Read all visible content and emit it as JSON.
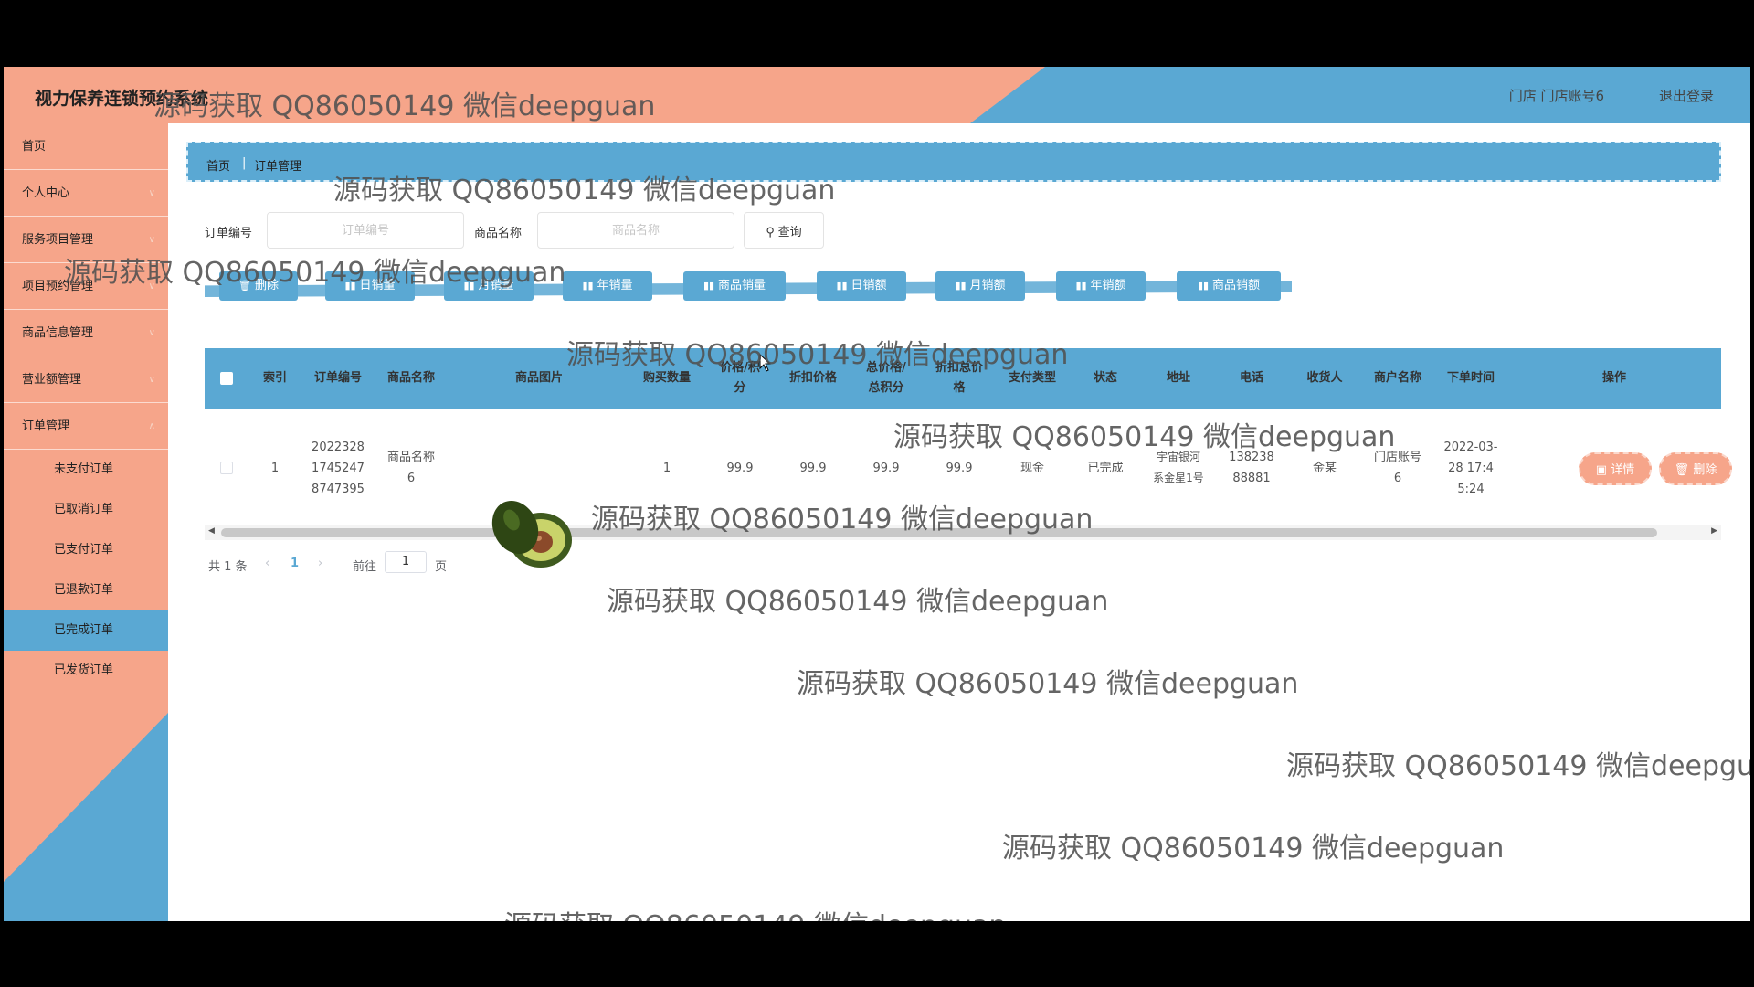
{
  "header": {
    "title": "视力保养连锁预约系统",
    "user": "门店 门店账号6",
    "logout": "退出登录"
  },
  "sidebar": {
    "items": [
      {
        "label": "首页"
      },
      {
        "label": "个人中心"
      },
      {
        "label": "服务项目管理"
      },
      {
        "label": "项目预约管理"
      },
      {
        "label": "商品信息管理"
      },
      {
        "label": "营业额管理"
      },
      {
        "label": "订单管理"
      }
    ],
    "sub_items": [
      {
        "label": "未支付订单"
      },
      {
        "label": "已取消订单"
      },
      {
        "label": "已支付订单"
      },
      {
        "label": "已退款订单"
      },
      {
        "label": "已完成订单"
      },
      {
        "label": "已发货订单"
      }
    ],
    "active_sub": "已完成订单"
  },
  "breadcrumb": {
    "home": "首页",
    "sep": "|",
    "current": "订单管理"
  },
  "search": {
    "order_no_label": "订单编号",
    "order_no_placeholder": "订单编号",
    "product_label": "商品名称",
    "product_placeholder": "商品名称",
    "query_button": "查询"
  },
  "toolbar": {
    "delete": "删除",
    "daily_volume": "日销量",
    "monthly_volume": "月销量",
    "yearly_volume": "年销量",
    "product_volume": "商品销量",
    "daily_amount": "日销额",
    "monthly_amount": "月销额",
    "yearly_amount": "年销额",
    "product_amount": "商品销额"
  },
  "table": {
    "headers": {
      "index": "索引",
      "order_no": "订单编号",
      "product_name": "商品名称",
      "product_image": "商品图片",
      "quantity": "购买数量",
      "price_points": "价格/积分",
      "discount_price": "折扣价格",
      "total_price_points": "总价格/总积分",
      "discount_total": "折扣总价格",
      "pay_type": "支付类型",
      "status": "状态",
      "address": "地址",
      "phone": "电话",
      "receiver": "收货人",
      "merchant": "商户名称",
      "order_time": "下单时间",
      "actions": "操作"
    },
    "rows": [
      {
        "index": "1",
        "order_no": "20223281745247 8747395",
        "product_name": "商品名称6",
        "quantity": "1",
        "price_points": "99.9",
        "discount_price": "99.9",
        "total_price_points": "99.9",
        "discount_total": "99.9",
        "pay_type": "现金",
        "status": "已完成",
        "address": "宇宙银河系金星1号",
        "phone": "13823888881",
        "receiver": "金某",
        "merchant": "门店账号6",
        "order_time": "2022-03-28 17:45:24",
        "detail_button": "详情",
        "delete_button": "删除"
      }
    ]
  },
  "pagination": {
    "total": "共 1 条",
    "current_page": "1",
    "goto_label": "前往",
    "goto_value": "1",
    "page_suffix": "页"
  },
  "watermark": "源码获取 QQ86050149 微信deepguan",
  "colors": {
    "accent_blue": "#5aa8d3",
    "accent_peach": "#f6a58a"
  }
}
